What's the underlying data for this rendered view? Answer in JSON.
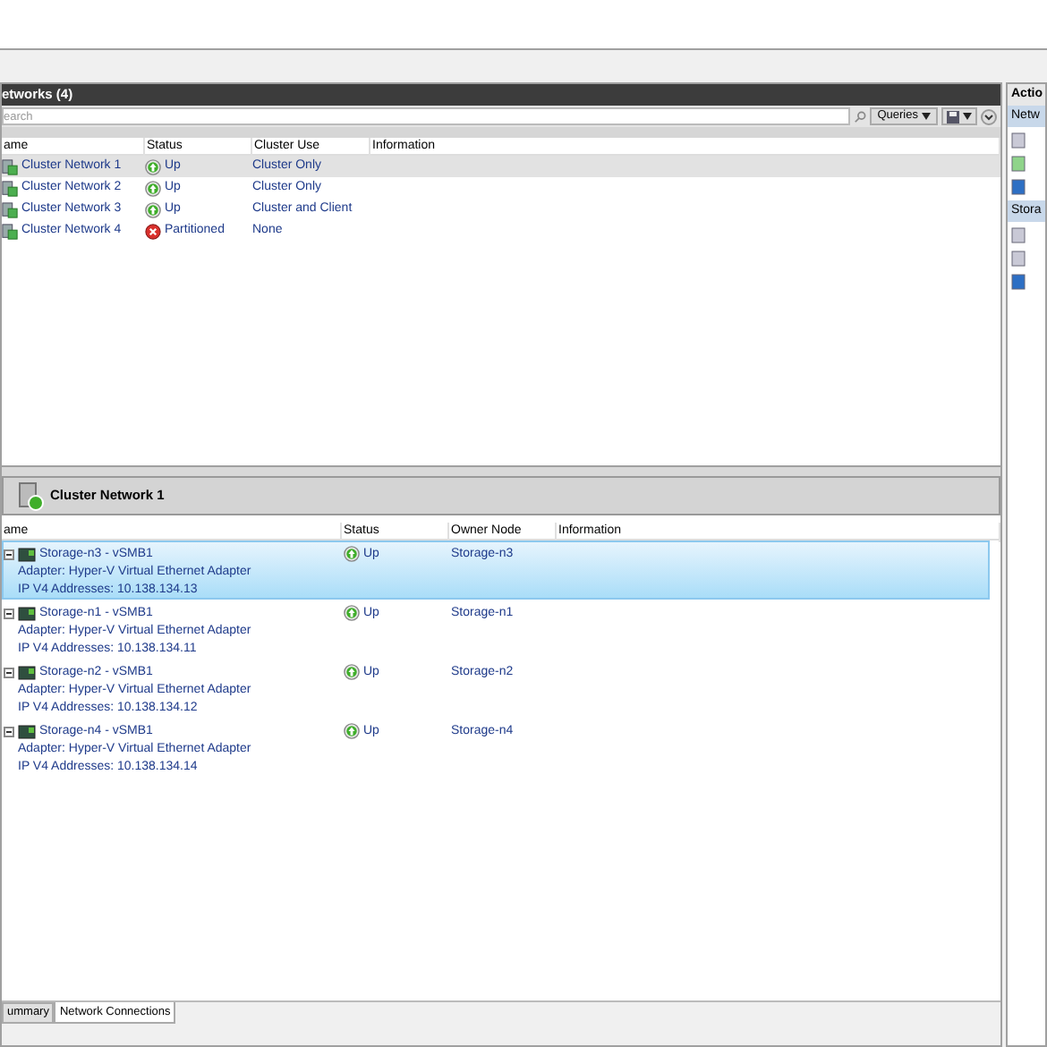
{
  "networks_panel": {
    "title": "etworks (4)",
    "search": {
      "placeholder": "earch"
    },
    "queries_button": "Queries",
    "columns": [
      "ame",
      "Status",
      "Cluster Use",
      "Information"
    ],
    "rows": [
      {
        "name": "Cluster Network 1",
        "status": "Up",
        "kind": "up",
        "cluster_use": "Cluster Only",
        "selected": true
      },
      {
        "name": "Cluster Network 2",
        "status": "Up",
        "kind": "up",
        "cluster_use": "Cluster Only",
        "selected": false
      },
      {
        "name": "Cluster Network 3",
        "status": "Up",
        "kind": "up",
        "cluster_use": "Cluster and Client",
        "selected": false
      },
      {
        "name": "Cluster Network 4",
        "status": "Partitioned",
        "kind": "error",
        "cluster_use": "None",
        "selected": false
      }
    ]
  },
  "details_panel": {
    "title": "Cluster Network 1",
    "columns": [
      "ame",
      "Status",
      "Owner Node",
      "Information"
    ],
    "rows": [
      {
        "name": "Storage-n3 - vSMB1",
        "adapter": "Adapter: Hyper-V Virtual Ethernet Adapter",
        "ip": "IP V4 Addresses: 10.138.134.13",
        "status": "Up",
        "kind": "up",
        "owner_node": "Storage-n3",
        "selected": true
      },
      {
        "name": "Storage-n1 - vSMB1",
        "adapter": "Adapter: Hyper-V Virtual Ethernet Adapter",
        "ip": "IP V4 Addresses: 10.138.134.11",
        "status": "Up",
        "kind": "up",
        "owner_node": "Storage-n1",
        "selected": false
      },
      {
        "name": "Storage-n2 - vSMB1",
        "adapter": "Adapter: Hyper-V Virtual Ethernet Adapter",
        "ip": "IP V4 Addresses: 10.138.134.12",
        "status": "Up",
        "kind": "up",
        "owner_node": "Storage-n2",
        "selected": false
      },
      {
        "name": "Storage-n4 - vSMB1",
        "adapter": "Adapter: Hyper-V Virtual Ethernet Adapter",
        "ip": "IP V4 Addresses: 10.138.134.14",
        "status": "Up",
        "kind": "up",
        "owner_node": "Storage-n4",
        "selected": false
      }
    ],
    "tabs": [
      {
        "label": "ummary",
        "selected": false
      },
      {
        "label": "Network Connections",
        "selected": true
      }
    ]
  },
  "actions_pane": {
    "title": "Actio",
    "sections": [
      {
        "title": "Netw"
      },
      {
        "title": "Stora"
      }
    ]
  }
}
